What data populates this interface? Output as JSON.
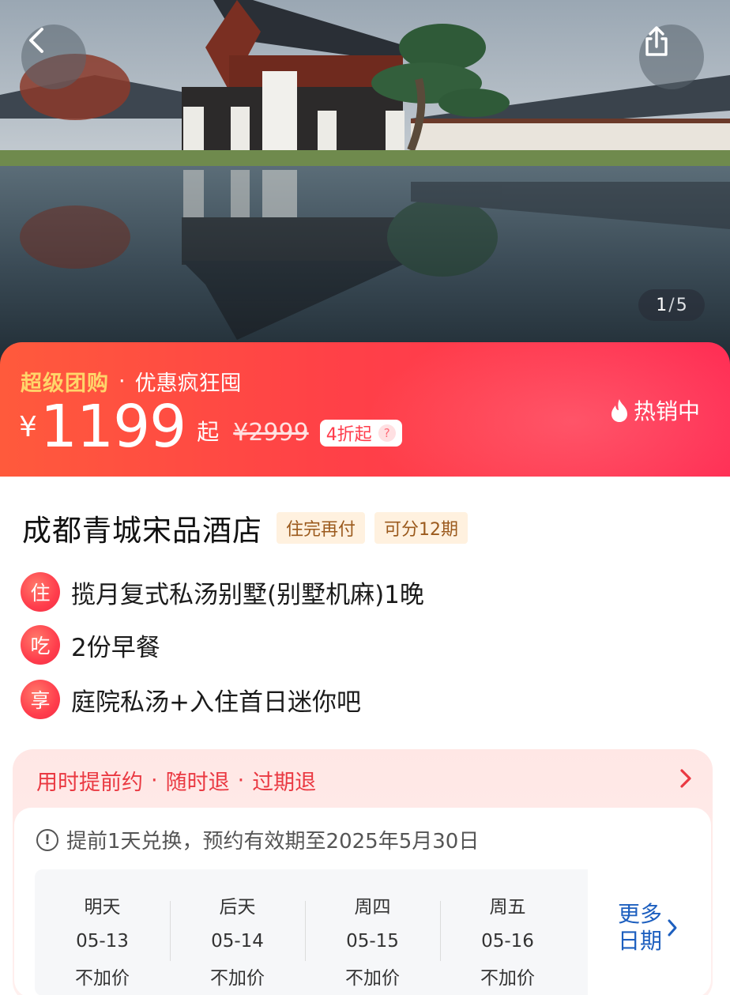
{
  "hero": {
    "sign_text": "成都青城宋品酒店",
    "pager": {
      "current": "1",
      "separator": "/",
      "total": "5"
    },
    "back_icon": "chevron-left-icon",
    "share_icon": "share-icon"
  },
  "promo": {
    "tag": "超级团购",
    "dot": "·",
    "slogan": "优惠疯狂囤",
    "currency": "¥",
    "price": "1199",
    "price_suffix": "起",
    "original_price": "¥2999",
    "discount": "4折起",
    "discount_help": "?",
    "hot_label": "热销中",
    "colors": {
      "banner_start": "#ff5a3c",
      "banner_end": "#ff2f55",
      "tag": "#ffd56a"
    }
  },
  "product": {
    "name": "成都青城宋品酒店",
    "chips": [
      "住完再付",
      "可分12期"
    ],
    "features": [
      {
        "badge": "住",
        "text": "揽月复式私汤别墅(别墅机麻)1晚"
      },
      {
        "badge": "吃",
        "text": "2份早餐"
      },
      {
        "badge": "享",
        "text": "庭院私汤+入住首日迷你吧"
      }
    ]
  },
  "booking": {
    "policies": [
      "用时提前约",
      "随时退",
      "过期退"
    ],
    "separator": "·",
    "notice_icon": "!",
    "notice": "提前1天兑换，预约有效期至2025年5月30日",
    "dates": [
      {
        "weekday": "明天",
        "date": "05-13",
        "price": "不加价"
      },
      {
        "weekday": "后天",
        "date": "05-14",
        "price": "不加价"
      },
      {
        "weekday": "周四",
        "date": "05-15",
        "price": "不加价"
      },
      {
        "weekday": "周五",
        "date": "05-16",
        "price": "不加价"
      }
    ],
    "more_dates": "更多日期",
    "colors": {
      "accent": "#ea3942",
      "link": "#1d5fbf"
    }
  }
}
